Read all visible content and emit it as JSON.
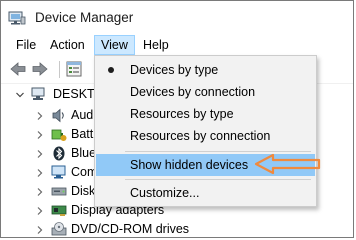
{
  "window": {
    "title": "Device Manager"
  },
  "menubar": {
    "file": "File",
    "action": "Action",
    "view": "View",
    "help": "Help"
  },
  "toolbar": {
    "icons": [
      "back-arrow-icon",
      "forward-arrow-icon",
      "properties-icon"
    ]
  },
  "tree": {
    "root": {
      "label": "DESKTOP"
    },
    "items": [
      {
        "label": "Aud",
        "icon": "audio-icon"
      },
      {
        "label": "Batt",
        "icon": "battery-icon"
      },
      {
        "label": "Blue",
        "icon": "bluetooth-icon"
      },
      {
        "label": "Com",
        "icon": "computer-icon"
      },
      {
        "label": "Disk",
        "icon": "disk-drive-icon"
      },
      {
        "label": "Display adapters",
        "icon": "display-adapter-icon"
      },
      {
        "label": "DVD/CD-ROM drives",
        "icon": "dvd-drive-icon"
      }
    ]
  },
  "view_menu": {
    "items": [
      {
        "label": "Devices by type",
        "checked": true
      },
      {
        "label": "Devices by connection"
      },
      {
        "label": "Resources by type"
      },
      {
        "label": "Resources by connection"
      },
      {
        "label": "Show hidden devices",
        "highlighted": true
      },
      {
        "label": "Customize..."
      }
    ]
  },
  "colors": {
    "highlight": "#91c9f7",
    "menu_active": "#cce8ff",
    "arrow": "#f08a3e"
  }
}
